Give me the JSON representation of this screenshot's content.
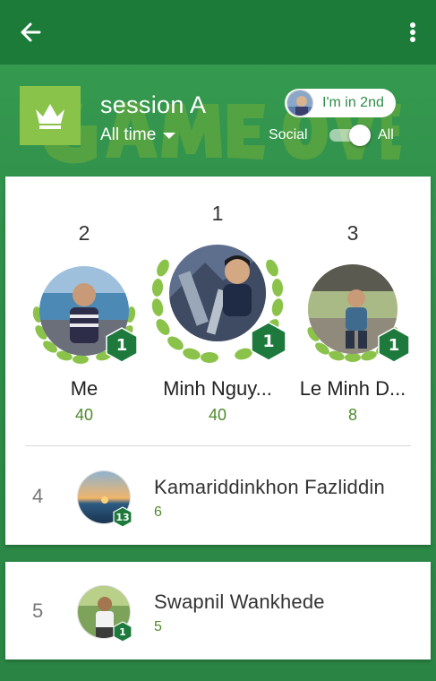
{
  "appbar": {
    "back_icon": "arrow-left-icon",
    "menu_icon": "more-vertical-icon"
  },
  "header": {
    "crown_icon": "crown-icon",
    "title": "session A",
    "time_filter": "All time",
    "rank_pill": "I'm in 2nd",
    "toggle_left_label": "Social",
    "toggle_right_label": "All",
    "toggle_on": true
  },
  "podium": [
    {
      "rank": "2",
      "name": "Me",
      "score": "40",
      "level": "1"
    },
    {
      "rank": "1",
      "name": "Minh Nguy...",
      "score": "40",
      "level": "1"
    },
    {
      "rank": "3",
      "name": "Le Minh D...",
      "score": "8",
      "level": "1"
    }
  ],
  "list": [
    {
      "rank": "4",
      "name": "Kamariddinkhon Fazliddin",
      "score": "6",
      "level": "13"
    },
    {
      "rank": "5",
      "name": "Swapnil Wankhede",
      "score": "5",
      "level": "1"
    }
  ],
  "colors": {
    "appbar": "#1d7b3a",
    "background": "#2b8a46",
    "crown_tile": "#8ac34a",
    "badge": "#1e7a3c",
    "score": "#4e8a2a"
  }
}
